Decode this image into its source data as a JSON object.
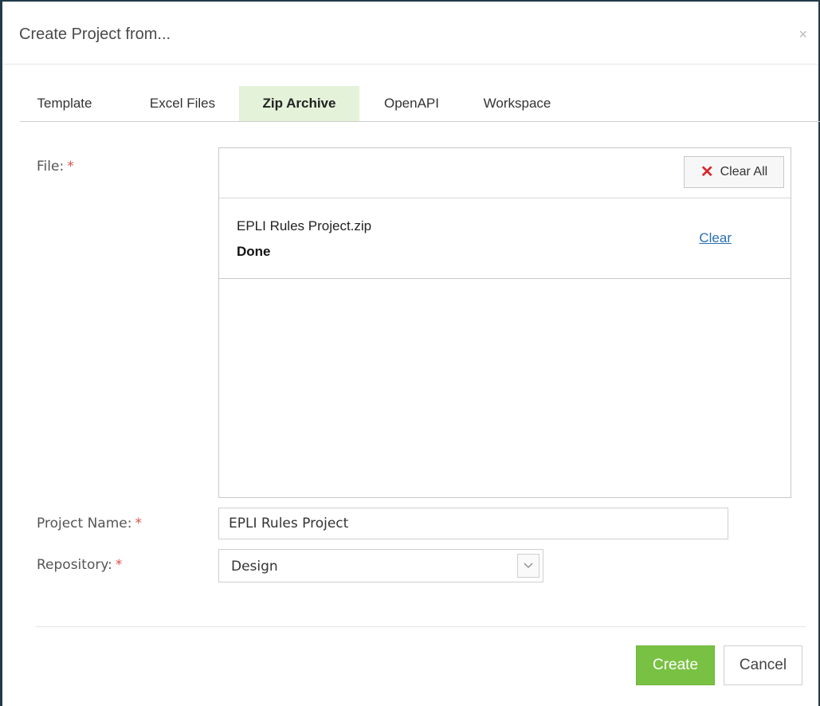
{
  "dialog": {
    "title": "Create Project from...",
    "close_label": "×"
  },
  "tabs": [
    {
      "label": "Template",
      "active": false
    },
    {
      "label": "Excel Files",
      "active": false
    },
    {
      "label": "Zip Archive",
      "active": true
    },
    {
      "label": "OpenAPI",
      "active": false
    },
    {
      "label": "Workspace",
      "active": false
    }
  ],
  "form": {
    "file_label": "File:",
    "project_name_label": "Project Name:",
    "repository_label": "Repository:",
    "required_mark": "*"
  },
  "upload": {
    "clear_all_label": "Clear All",
    "clear_all_icon": "x-icon",
    "files": [
      {
        "name": "EPLI Rules Project.zip",
        "status": "Done",
        "clear_label": "Clear"
      }
    ]
  },
  "project_name": {
    "value": "EPLI Rules Project"
  },
  "repository": {
    "selected": "Design",
    "arrow_icon": "chevron-down-icon"
  },
  "footer": {
    "create_label": "Create",
    "cancel_label": "Cancel"
  },
  "colors": {
    "accent_green": "#79c143",
    "active_tab_bg": "#e4f2d9",
    "required_red": "#d9534f",
    "link_blue": "#2a6fb0"
  }
}
